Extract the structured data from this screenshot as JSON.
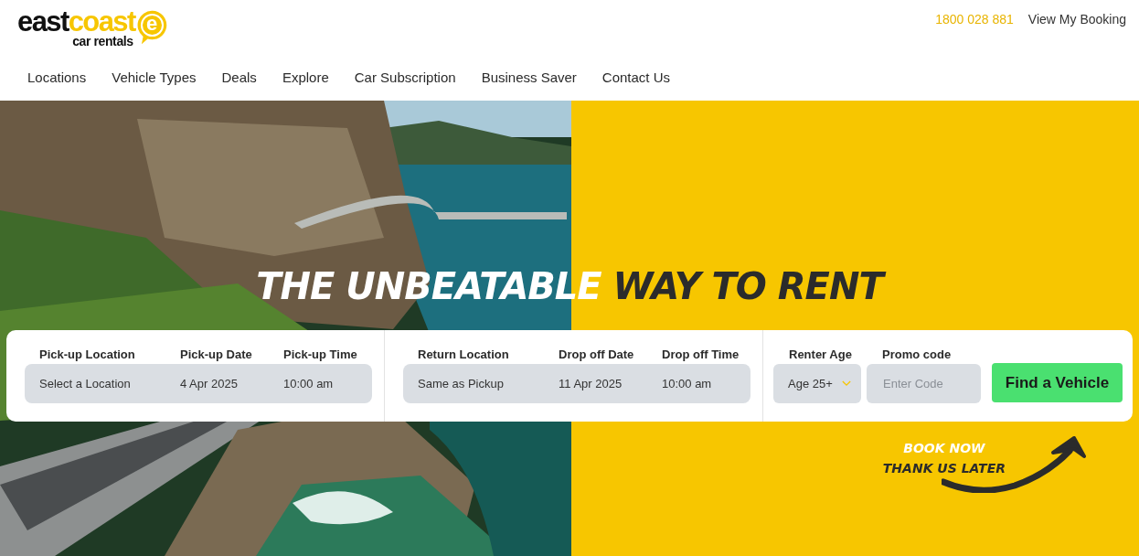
{
  "logo": {
    "parts": [
      {
        "text": "east",
        "color": "#111111"
      },
      {
        "text": "coast",
        "color": "#f7c600"
      }
    ],
    "tagline": "car rentals",
    "badge_letter": "e"
  },
  "top_links": [
    {
      "label": "1800 028 881",
      "kind": "phone"
    },
    {
      "label": "View My Booking",
      "kind": "plain"
    }
  ],
  "nav": [
    "Locations",
    "Vehicle Types",
    "Deals",
    "Explore",
    "Car Subscription",
    "Business Saver",
    "Contact Us"
  ],
  "hero": {
    "headline": [
      {
        "text": "THE UNBEATABLE",
        "color": "#ffffff"
      },
      {
        "text": "WAY TO RENT",
        "color": "#2b2b2b"
      }
    ],
    "booking": {
      "groups": [
        {
          "fields": [
            {
              "label": "Pick-up Location",
              "value": "Select a Location",
              "kind": "location"
            },
            {
              "label": "Pick-up Date",
              "value": "4 Apr 2025",
              "kind": "date"
            },
            {
              "label": "Pick-up Time",
              "value": "10:00 am",
              "kind": "time"
            }
          ]
        },
        {
          "fields": [
            {
              "label": "Return Location",
              "value": "Same as Pickup",
              "kind": "location"
            },
            {
              "label": "Drop off Date",
              "value": "11 Apr 2025",
              "kind": "date"
            },
            {
              "label": "Drop off Time",
              "value": "10:00 am",
              "kind": "time"
            }
          ]
        }
      ],
      "renter_age": {
        "label": "Renter Age",
        "value": "Age 25+"
      },
      "promo": {
        "label": "Promo code",
        "placeholder": "Enter Code"
      },
      "submit": "Find a Vehicle"
    },
    "tagline": [
      {
        "text": "BOOK NOW",
        "color": "#ffffff"
      },
      {
        "text": "THANK US LATER",
        "color": "#2b2b2b"
      }
    ]
  }
}
